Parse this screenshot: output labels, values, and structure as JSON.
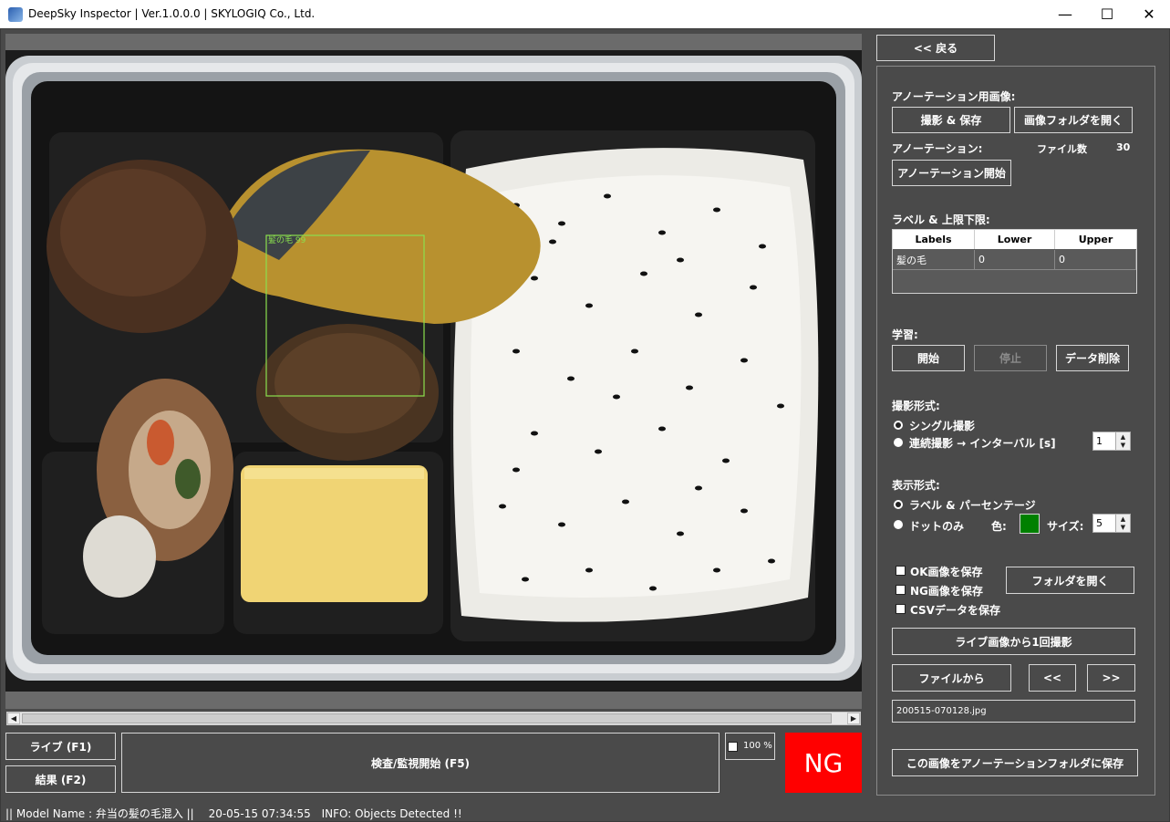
{
  "window": {
    "title": "DeepSky Inspector | Ver.1.0.0.0 | SKYLOGIQ Co., Ltd.",
    "minimize": "—",
    "maximize": "☐",
    "close": "✕"
  },
  "image": {
    "detection_label": "髪の毛 99",
    "detection_color": "#8be04e"
  },
  "controls": {
    "live_button": "ライブ (F1)",
    "result_button": "結果 (F2)",
    "inspect_button": "検査/監視開始 (F5)",
    "zoom_label": "100 %",
    "verdict": "NG",
    "verdict_color": "#ff0000"
  },
  "side": {
    "back_button": "<< 戻る",
    "annotation_images_label": "アノーテーション用画像:",
    "capture_save_button": "撮影 & 保存",
    "open_image_folder_button": "画像フォルダを開く",
    "annotation_label": "アノーテーション:",
    "file_count_label": "ファイル数",
    "file_count": "30",
    "annotation_start_button": "アノーテーション開始",
    "labels_limits_label": "ラベル & 上限下限:",
    "table": {
      "headers": [
        "Labels",
        "Lower",
        "Upper"
      ],
      "rows": [
        [
          "髪の毛",
          "0",
          "0"
        ]
      ]
    },
    "learning_label": "学習:",
    "learning_start_button": "開始",
    "learning_stop_button": "停止",
    "delete_data_button": "データ削除",
    "capture_mode_label": "撮影形式:",
    "single_capture": "シングル撮影",
    "continuous_capture": "連続撮影 → インターバル [s]",
    "interval_value": "1",
    "display_mode_label": "表示形式:",
    "label_percentage": "ラベル & パーセンテージ",
    "dots_only": "ドットのみ",
    "color_label": "色:",
    "dot_color": "#008000",
    "size_label": "サイズ:",
    "size_value": "5",
    "save_ok": "OK画像を保存",
    "save_ng": "NG画像を保存",
    "save_csv": "CSVデータを保存",
    "open_folder_button": "フォルダを開く",
    "capture_once_button": "ライブ画像から1回撮影",
    "from_file_button": "ファイルから",
    "prev_button": "<<",
    "next_button": ">>",
    "filename": "200515-070128.jpg",
    "save_to_annotation_button": "この画像をアノーテーションフォルダに保存"
  },
  "status_bar": {
    "model_text": "|| Model Name : 弁当の髪の毛混入 ||",
    "timestamp": "20-05-15 07:34:55",
    "info_text": "INFO:   Objects Detected !!"
  }
}
